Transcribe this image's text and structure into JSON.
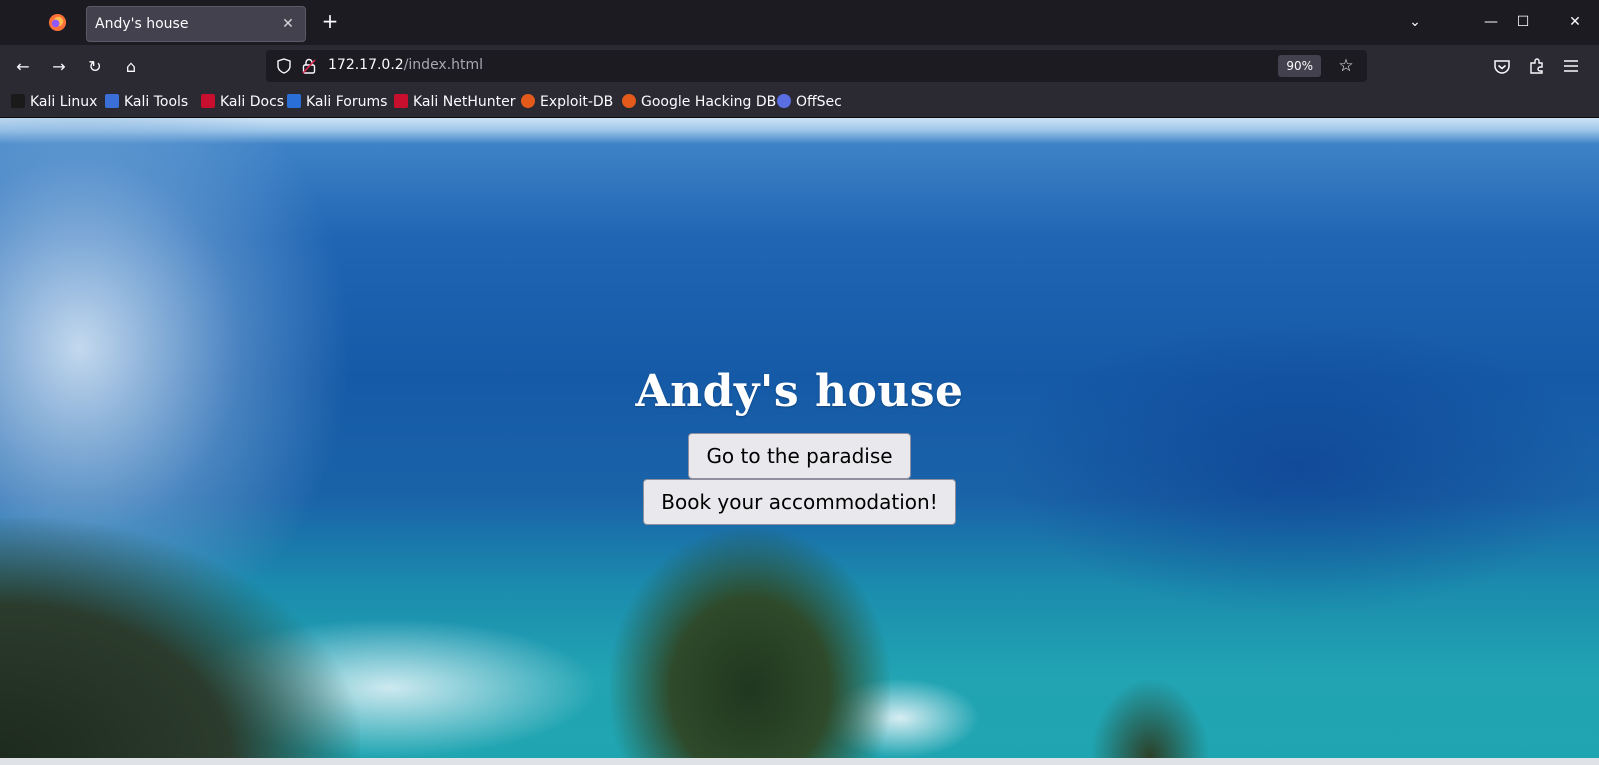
{
  "browser": {
    "tab": {
      "title": "Andy's house",
      "close_glyph": "✕"
    },
    "new_tab_glyph": "+",
    "window_controls": {
      "list": "⌄",
      "minimize": "—",
      "maximize": "☐",
      "close": "✕"
    },
    "nav": {
      "back": "←",
      "forward": "→",
      "reload": "↻",
      "home": "⌂"
    },
    "url": {
      "host": "172.17.0.2",
      "path": "/index.html",
      "zoom": "90%"
    },
    "toolbar_icons": [
      "pocket-icon",
      "extensions-icon",
      "menu-icon"
    ]
  },
  "bookmarks": [
    {
      "label": "Kali Linux",
      "color": "#1a1a1a"
    },
    {
      "label": "Kali Tools",
      "color": "#3a6fd8"
    },
    {
      "label": "Kali Docs",
      "color": "#c8102e"
    },
    {
      "label": "Kali Forums",
      "color": "#2a6fd6"
    },
    {
      "label": "Kali NetHunter",
      "color": "#c8102e"
    },
    {
      "label": "Exploit-DB",
      "color": "#e45a1b"
    },
    {
      "label": "Google Hacking DB",
      "color": "#e45a1b"
    },
    {
      "label": "OffSec",
      "color": "#5b6ee1"
    }
  ],
  "page": {
    "title": "Andy's house",
    "buttons": {
      "paradise": "Go to the paradise",
      "book": "Book your accommodation!"
    }
  }
}
